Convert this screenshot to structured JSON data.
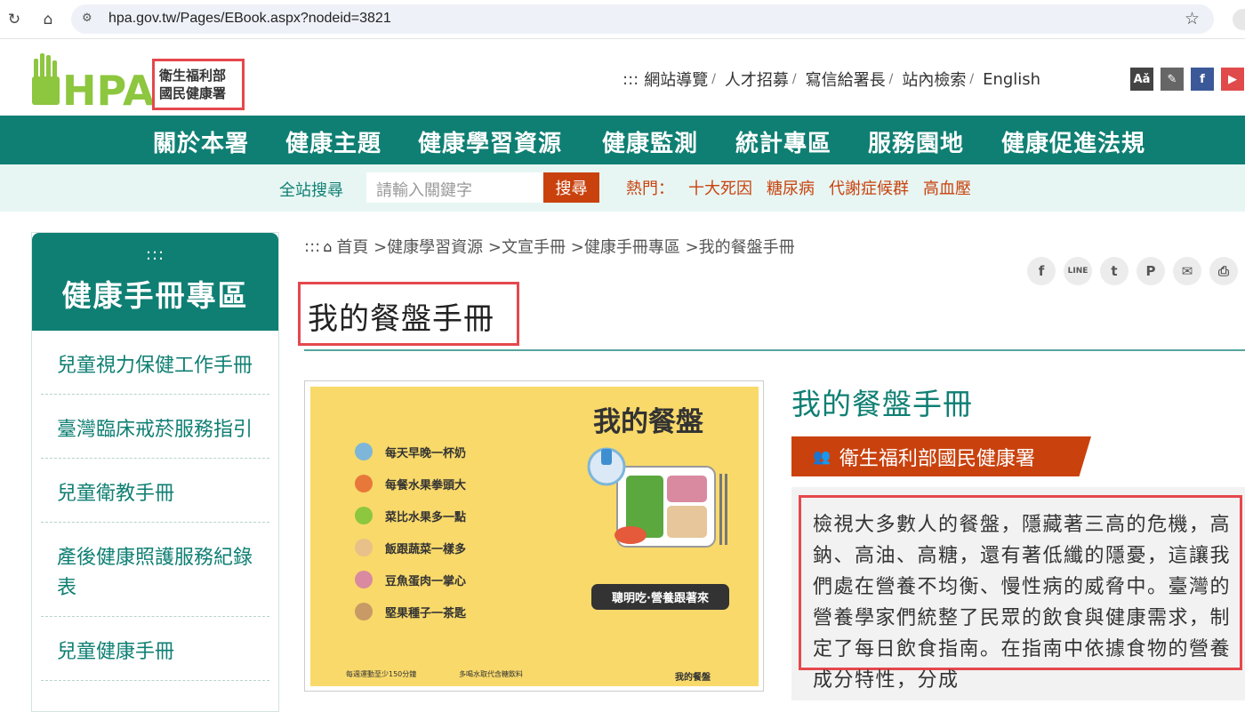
{
  "browser": {
    "url": "hpa.gov.tw/Pages/EBook.aspx?nodeid=3821"
  },
  "header": {
    "logo_text": "HPA",
    "org_line1": "衛生福利部",
    "org_line2": "國民健康署",
    "lead": ":::",
    "links": [
      "網站導覽",
      "人才招募",
      "寫信給署長",
      "站內檢索",
      "English"
    ],
    "tool_buttons": [
      "font-size-icon",
      "brush-icon",
      "facebook-icon",
      "youtube-icon"
    ]
  },
  "nav": {
    "items": [
      "關於本署",
      "健康主題",
      "健康學習資源",
      "健康監測",
      "統計專區",
      "服務園地",
      "健康促進法規"
    ]
  },
  "search": {
    "label": "全站搜尋",
    "placeholder": "請輸入關鍵字",
    "button": "搜尋",
    "hot_label": "熱門：",
    "hot_items": [
      "十大死因",
      "糖尿病",
      "代謝症候群",
      "高血壓"
    ]
  },
  "sidebar": {
    "dots": ":::",
    "title": "健康手冊專區",
    "items": [
      "兒童視力保健工作手冊",
      "臺灣臨床戒菸服務指引",
      "兒童衛教手冊",
      "產後健康照護服務紀錄表",
      "兒童健康手冊"
    ]
  },
  "breadcrumb": {
    "lead": ":::",
    "items": [
      "首頁",
      ">健康學習資源",
      ">文宣手冊",
      ">健康手冊專區",
      ">我的餐盤手冊"
    ]
  },
  "share": [
    "facebook-icon",
    "line-icon",
    "twitter-icon",
    "plurk-icon",
    "mail-icon",
    "print-icon"
  ],
  "page": {
    "title": "我的餐盤手冊"
  },
  "cover": {
    "title": "我的餐盤",
    "lines": [
      "每天早晚一杯奶",
      "每餐水果拳頭大",
      "菜比水果多一點",
      "飯跟蔬菜一樣多",
      "豆魚蛋肉一掌心",
      "堅果種子一茶匙"
    ],
    "slogan": "聰明吃·營養跟著來",
    "foot1": "每週運動至少150分鐘",
    "foot2": "多喝水取代含糖飲料",
    "brand": "我的餐盤"
  },
  "book": {
    "title": "我的餐盤手冊",
    "publisher": "衛生福利部國民健康署",
    "description": "檢視大多數人的餐盤，隱藏著三高的危機，高鈉、高油、高糖，還有著低纖的隱憂，這讓我們處在營養不均衡、慢性病的威脅中。臺灣的營養學家們統整了民眾的飲食與健康需求，制定了每日飲食指南。在指南中依據食物的營養成分特性，分成"
  },
  "colors": {
    "primary": "#0f7f73",
    "accent": "#c9420e",
    "highlight": "#e5484d",
    "cover_bg": "#f8d96a",
    "logo": "#8dc63f"
  }
}
